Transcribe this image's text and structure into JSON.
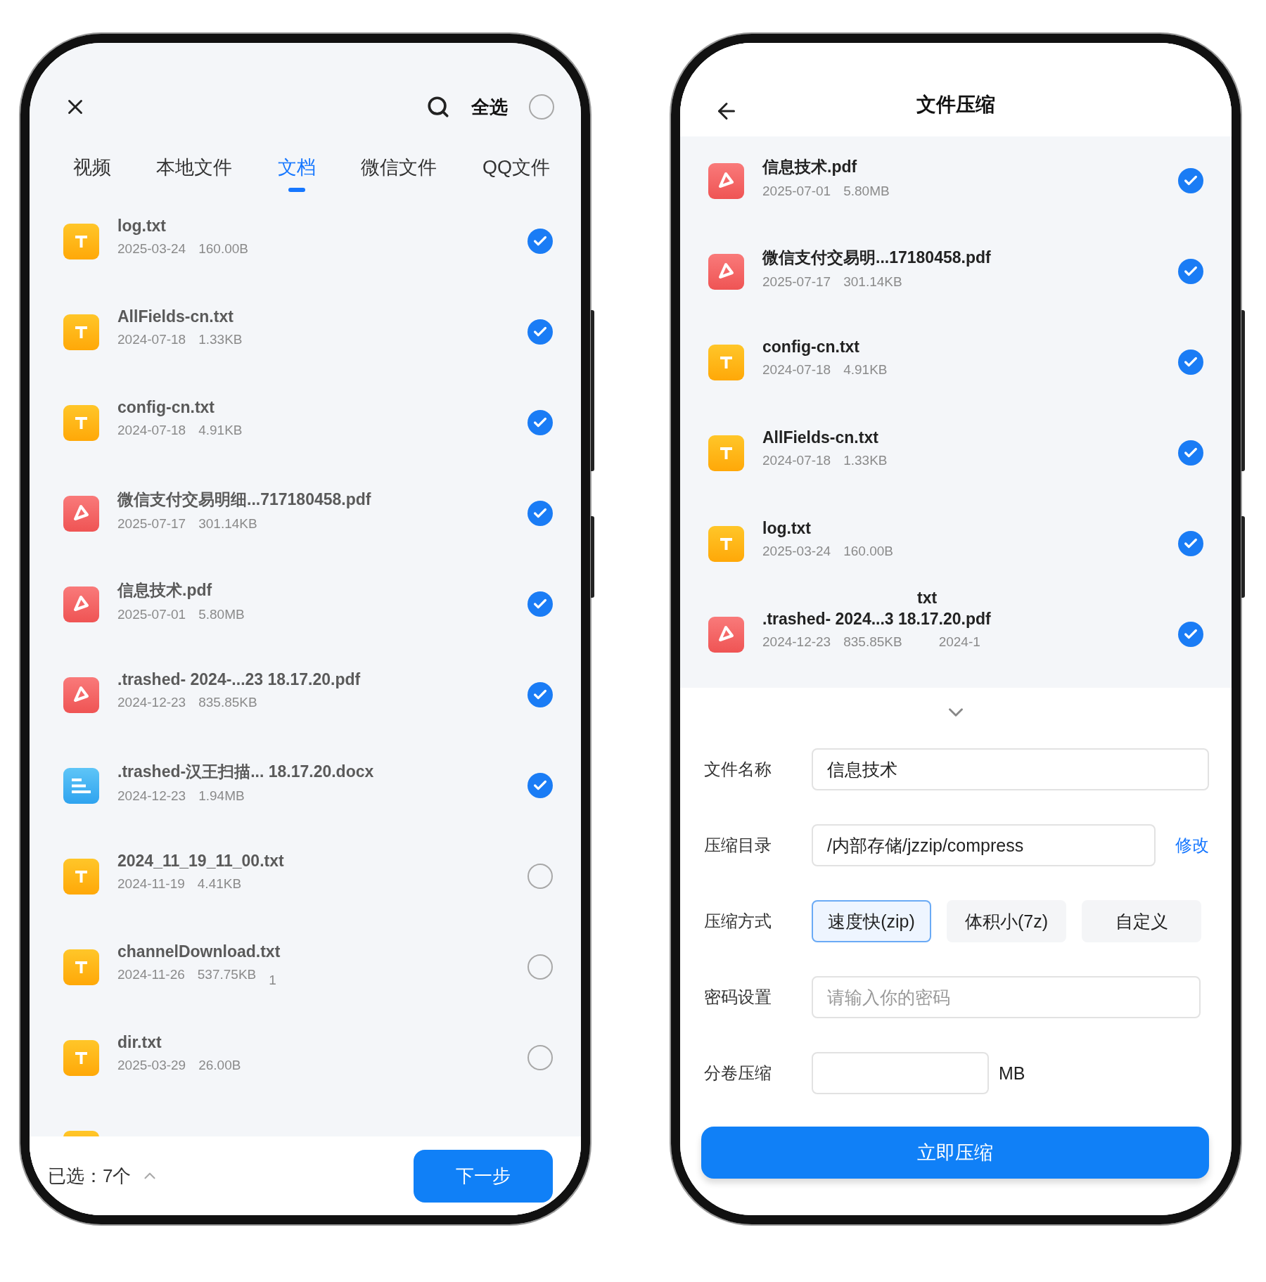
{
  "left_screen": {
    "select_all": {
      "label": "全选",
      "checked": false
    },
    "tabs": [
      {
        "label": "视频",
        "selected": false
      },
      {
        "label": "本地文件",
        "selected": false
      },
      {
        "label": "文档",
        "selected": true
      },
      {
        "label": "微信文件",
        "selected": false
      },
      {
        "label": "QQ文件",
        "selected": false
      }
    ],
    "files": [
      {
        "kind": "txt",
        "name": "log.txt",
        "date": "2025-03-24",
        "size": "160.00B",
        "checked": true
      },
      {
        "kind": "txt",
        "name": "AllFields-cn.txt",
        "date": "2024-07-18",
        "size": "1.33KB",
        "checked": true
      },
      {
        "kind": "txt",
        "name": "config-cn.txt",
        "date": "2024-07-18",
        "size": "4.91KB",
        "checked": true
      },
      {
        "kind": "pdf",
        "name": "微信支付交易明细...717180458.pdf",
        "date": "2025-07-17",
        "size": "301.14KB",
        "checked": true
      },
      {
        "kind": "pdf",
        "name": "信息技术.pdf",
        "date": "2025-07-01",
        "size": "5.80MB",
        "checked": true
      },
      {
        "kind": "pdf",
        "name": ".trashed- 2024-...23 18.17.20.pdf",
        "date": "2024-12-23",
        "size": "835.85KB",
        "checked": true
      },
      {
        "kind": "docx",
        "name": ".trashed-汉王扫描... 18.17.20.docx",
        "date": "2024-12-23",
        "size": "1.94MB",
        "checked": true
      },
      {
        "kind": "txt",
        "name": "2024_11_19_11_00.txt",
        "date": "2024-11-19",
        "size": "4.41KB",
        "checked": false
      },
      {
        "kind": "txt",
        "name": "channelDownload.txt",
        "date": "2024-11-26",
        "size": "537.75KB",
        "extra": "1",
        "checked": false
      },
      {
        "kind": "txt",
        "name": "dir.txt",
        "date": "2025-03-29",
        "size": "26.00B",
        "checked": false
      },
      {
        "kind": "txt"
      }
    ],
    "footer": {
      "selected_count": "已选：7个",
      "next_button": "下一步"
    }
  },
  "right_screen": {
    "title": "文件压缩",
    "files": [
      {
        "kind": "pdf",
        "name": "信息技术.pdf",
        "date": "2025-07-01",
        "size": "5.80MB",
        "checked": true
      },
      {
        "kind": "pdf",
        "name": "微信支付交易明...17180458.pdf",
        "date": "2025-07-17",
        "size": "301.14KB",
        "checked": true
      },
      {
        "kind": "txt",
        "name": "config-cn.txt",
        "date": "2024-07-18",
        "size": "4.91KB",
        "checked": true
      },
      {
        "kind": "txt",
        "name": "AllFields-cn.txt",
        "date": "2024-07-18",
        "size": "1.33KB",
        "checked": true
      },
      {
        "kind": "txt",
        "name": "log.txt",
        "date": "2025-03-24",
        "size": "160.00B",
        "checked": true
      },
      {
        "kind": "pdf",
        "name": ".trashed- 2024...3 18.17.20.pdf",
        "overlay": "txt",
        "date": "2024-12-23",
        "size": "835.85KB",
        "extra": "2024-1",
        "checked": true
      }
    ],
    "form": {
      "file_name": {
        "label": "文件名称",
        "value": "信息技术"
      },
      "directory": {
        "label": "压缩目录",
        "value": "/内部存储/jzzip/compress",
        "action": "修改"
      },
      "method": {
        "label": "压缩方式",
        "options": [
          {
            "label": "速度快(zip)",
            "selected": true
          },
          {
            "label": "体积小(7z)",
            "selected": false
          },
          {
            "label": "自定义",
            "selected": false
          }
        ]
      },
      "password": {
        "label": "密码设置",
        "placeholder": "请输入你的密码"
      },
      "split": {
        "label": "分卷压缩",
        "unit": "MB"
      }
    },
    "submit": "立即压缩"
  }
}
